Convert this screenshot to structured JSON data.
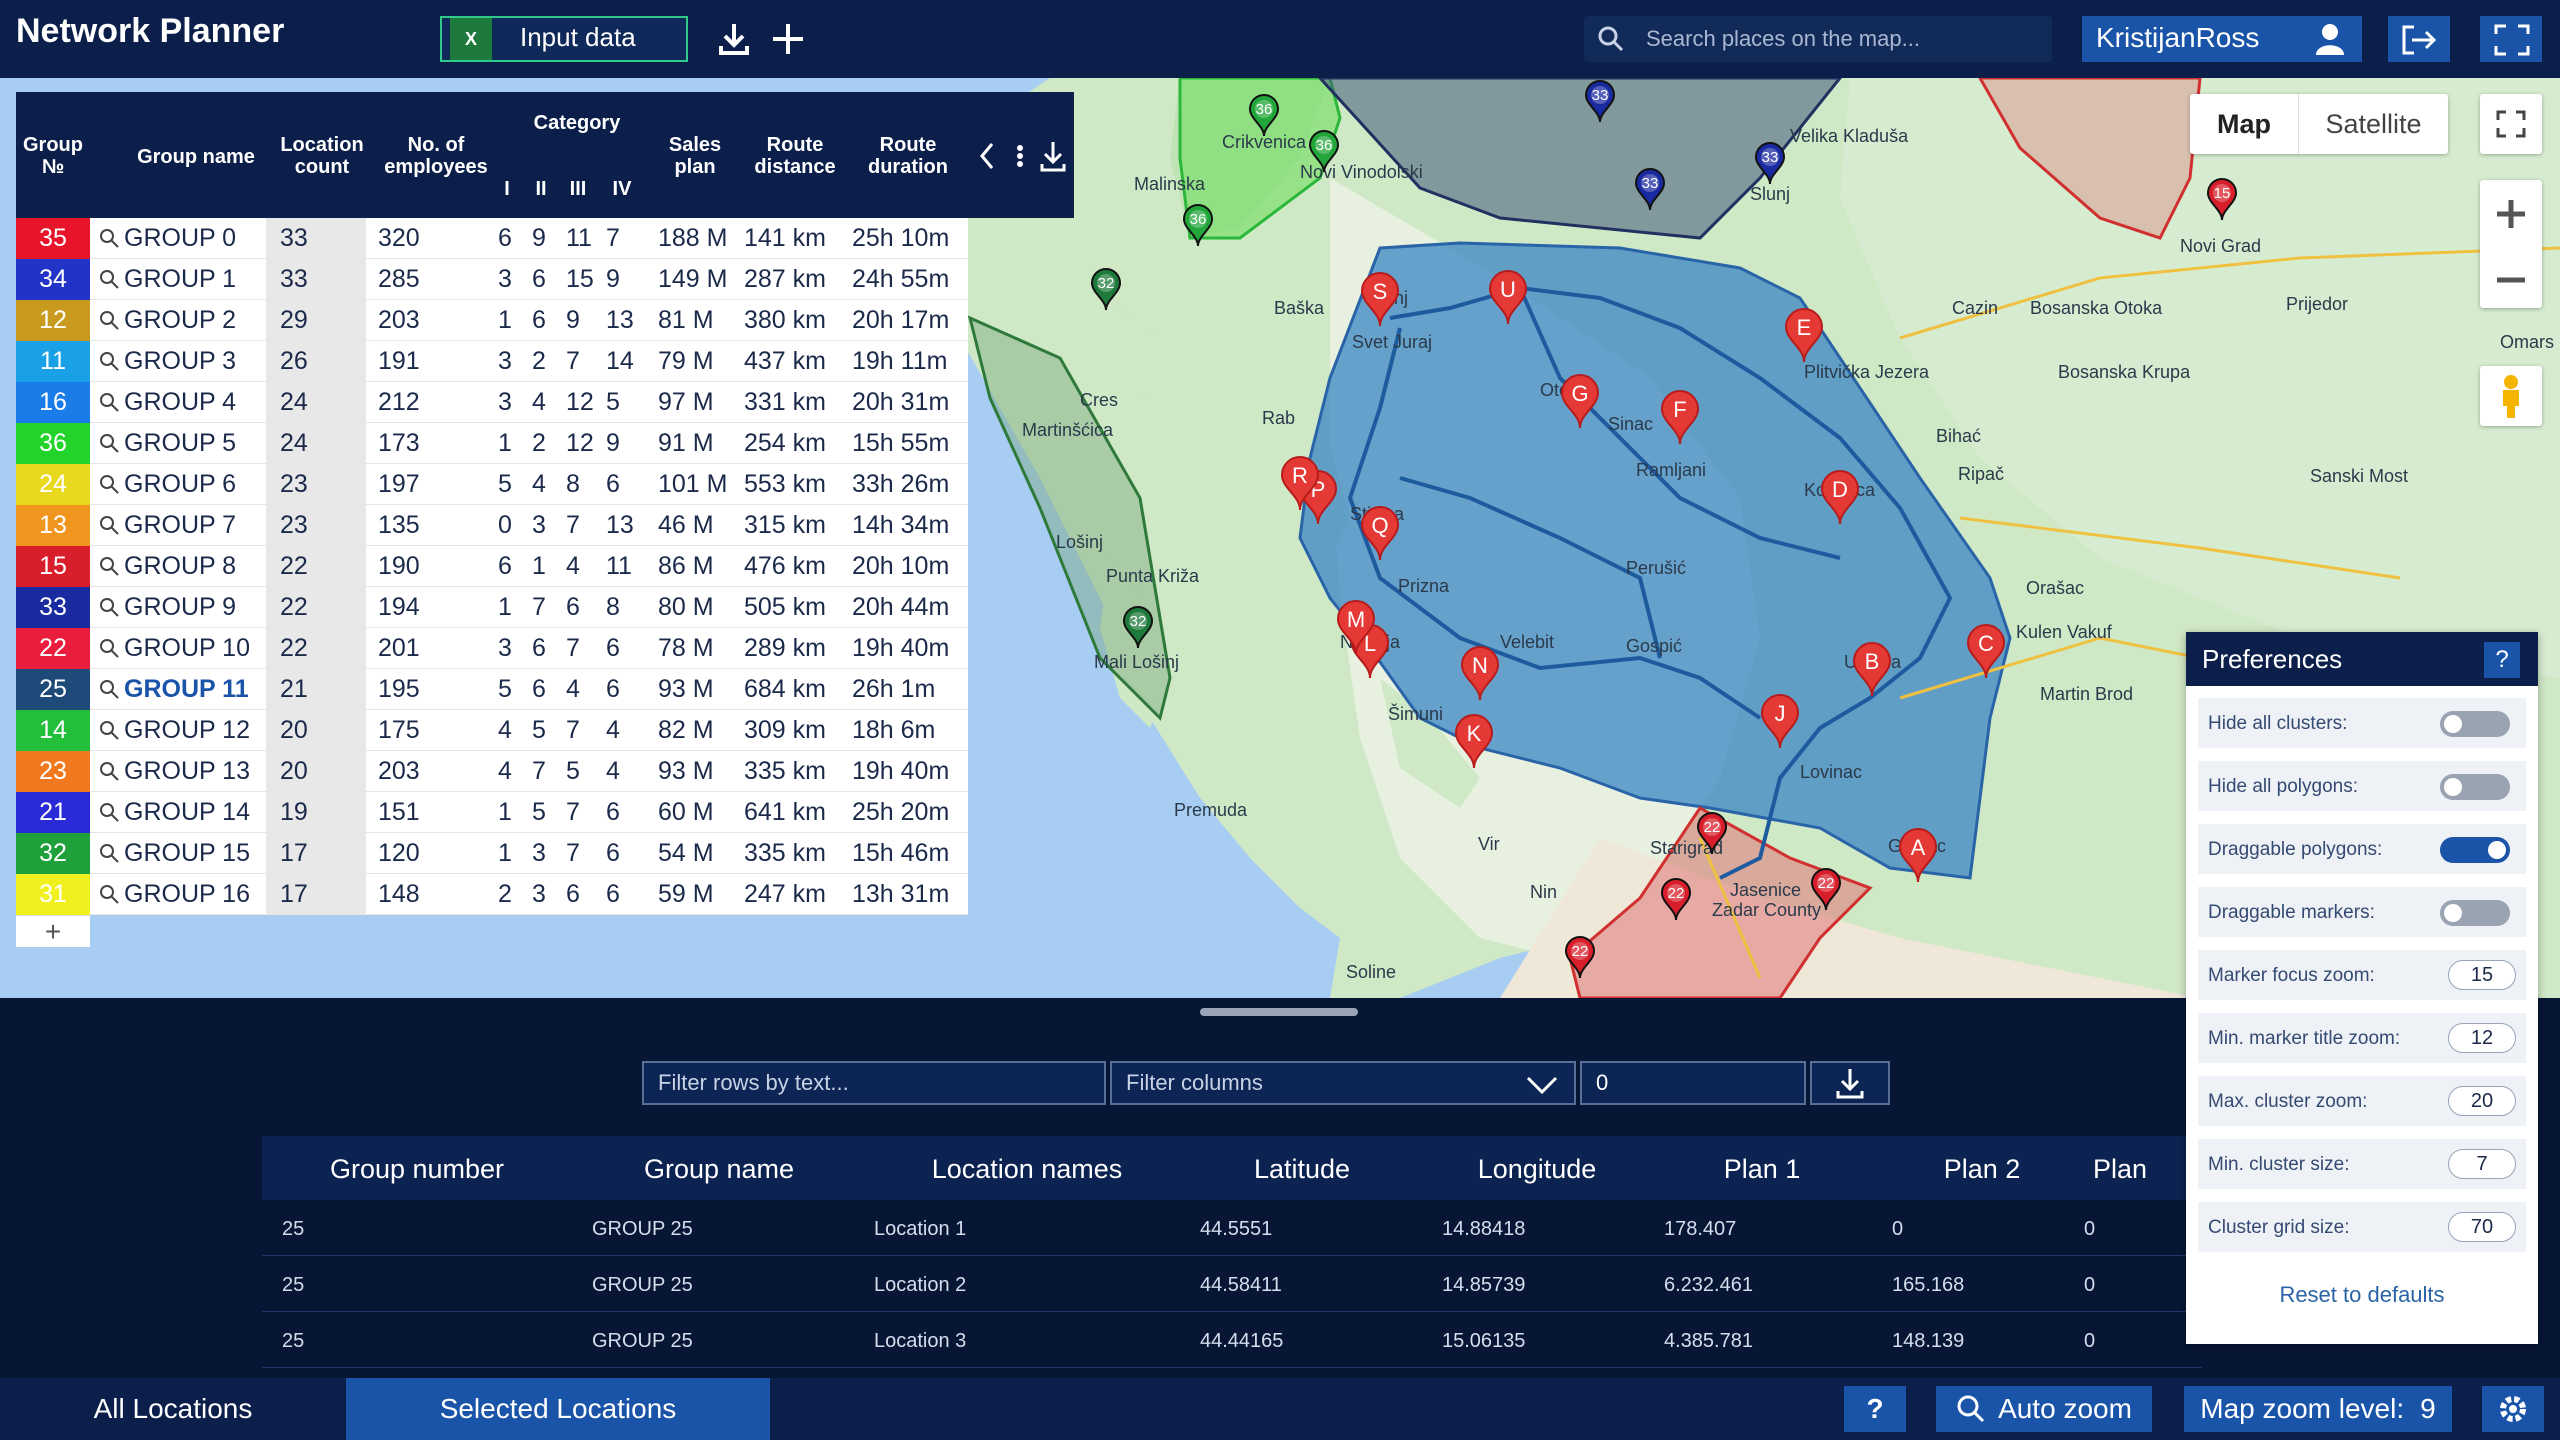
{
  "app": {
    "title": "Network Planner",
    "input_data_label": "Input data",
    "search_placeholder": "Search places on the map...",
    "user_name": "KristijanRoss"
  },
  "map": {
    "type_map": "Map",
    "type_satellite": "Satellite",
    "places": [
      "Crikvenica",
      "Novi Vinodolski",
      "Malinska",
      "Baška",
      "Senj",
      "Svet Juraj",
      "Cres",
      "Martinšćica",
      "Lošinj",
      "Punta Križa",
      "Mali Lošinj",
      "Otočac",
      "Sinac",
      "Plitvička Jezera",
      "Ramljani",
      "Korenica",
      "Bihać",
      "Ripač",
      "Perušić",
      "Gospić",
      "Udbina",
      "Lovinac",
      "Velebit",
      "Premuda",
      "Šimuni",
      "Novalja",
      "Prizna",
      "Stinica",
      "Rab",
      "Vir",
      "Starigrad",
      "Jasenice",
      "Zadar County",
      "Nin",
      "Soline",
      "Gračac",
      "Velika Kladuša",
      "Cazin",
      "Bosanska Otoka",
      "Bosanska Krupa",
      "Prijedor",
      "Sanski Most",
      "Novi Grad",
      "Kulen Vakuf",
      "Orašac",
      "Martin Brod",
      "Slunj",
      "Omars"
    ],
    "pins": [
      "A",
      "B",
      "C",
      "D",
      "E",
      "F",
      "G",
      "J",
      "K",
      "L",
      "M",
      "N",
      "P",
      "Q",
      "R",
      "S",
      "U"
    ],
    "cluster_labels": [
      "33",
      "33",
      "33",
      "36",
      "36",
      "36",
      "32",
      "32",
      "22",
      "22",
      "22",
      "22",
      "15"
    ]
  },
  "group_table": {
    "headers": {
      "group_no": "Group №",
      "group_name": "Group name",
      "location_count": "Location count",
      "employees": "No. of employees",
      "category": "Category",
      "cat_I": "I",
      "cat_II": "II",
      "cat_III": "III",
      "cat_IV": "IV",
      "sales_plan": "Sales plan",
      "route_distance": "Route distance",
      "route_duration": "Route duration"
    },
    "rows": [
      {
        "num": "35",
        "color": "#e8142a",
        "name": "GROUP 0",
        "count": "33",
        "emp": "320",
        "c1": "6",
        "c2": "9",
        "c3": "11",
        "c4": "7",
        "sales": "188 M",
        "dist": "141 km",
        "dur": "25h 10m"
      },
      {
        "num": "34",
        "color": "#2233c8",
        "name": "GROUP 1",
        "count": "33",
        "emp": "285",
        "c1": "3",
        "c2": "6",
        "c3": "15",
        "c4": "9",
        "sales": "149 M",
        "dist": "287 km",
        "dur": "24h 55m"
      },
      {
        "num": "12",
        "color": "#c89b1e",
        "name": "GROUP 2",
        "count": "29",
        "emp": "203",
        "c1": "1",
        "c2": "6",
        "c3": "9",
        "c4": "13",
        "sales": "81 M",
        "dist": "380 km",
        "dur": "20h 17m"
      },
      {
        "num": "11",
        "color": "#1aa0e6",
        "name": "GROUP 3",
        "count": "26",
        "emp": "191",
        "c1": "3",
        "c2": "2",
        "c3": "7",
        "c4": "14",
        "sales": "79 M",
        "dist": "437 km",
        "dur": "19h 11m"
      },
      {
        "num": "16",
        "color": "#1a7ce8",
        "name": "GROUP 4",
        "count": "24",
        "emp": "212",
        "c1": "3",
        "c2": "4",
        "c3": "12",
        "c4": "5",
        "sales": "97 M",
        "dist": "331 km",
        "dur": "20h 31m"
      },
      {
        "num": "36",
        "color": "#22d42a",
        "name": "GROUP 5",
        "count": "24",
        "emp": "173",
        "c1": "1",
        "c2": "2",
        "c3": "12",
        "c4": "9",
        "sales": "91 M",
        "dist": "254 km",
        "dur": "15h 55m"
      },
      {
        "num": "24",
        "color": "#e8d81e",
        "name": "GROUP 6",
        "count": "23",
        "emp": "197",
        "c1": "5",
        "c2": "4",
        "c3": "8",
        "c4": "6",
        "sales": "101 M",
        "dist": "553 km",
        "dur": "33h 26m"
      },
      {
        "num": "13",
        "color": "#f0961e",
        "name": "GROUP 7",
        "count": "23",
        "emp": "135",
        "c1": "0",
        "c2": "3",
        "c3": "7",
        "c4": "13",
        "sales": "46 M",
        "dist": "315 km",
        "dur": "14h 34m"
      },
      {
        "num": "15",
        "color": "#d81e2a",
        "name": "GROUP 8",
        "count": "22",
        "emp": "190",
        "c1": "6",
        "c2": "1",
        "c3": "4",
        "c4": "11",
        "sales": "86 M",
        "dist": "476 km",
        "dur": "20h 10m"
      },
      {
        "num": "33",
        "color": "#1a2aa0",
        "name": "GROUP 9",
        "count": "22",
        "emp": "194",
        "c1": "1",
        "c2": "7",
        "c3": "6",
        "c4": "8",
        "sales": "80 M",
        "dist": "505 km",
        "dur": "20h 44m"
      },
      {
        "num": "22",
        "color": "#e81e3c",
        "name": "GROUP 10",
        "count": "22",
        "emp": "201",
        "c1": "3",
        "c2": "6",
        "c3": "7",
        "c4": "6",
        "sales": "78 M",
        "dist": "289 km",
        "dur": "19h 40m"
      },
      {
        "num": "25",
        "color": "#1e4a7a",
        "name": "GROUP 11",
        "count": "21",
        "emp": "195",
        "c1": "5",
        "c2": "6",
        "c3": "4",
        "c4": "6",
        "sales": "93 M",
        "dist": "684 km",
        "dur": "26h 1m"
      },
      {
        "num": "14",
        "color": "#22c03a",
        "name": "GROUP 12",
        "count": "20",
        "emp": "175",
        "c1": "4",
        "c2": "5",
        "c3": "7",
        "c4": "4",
        "sales": "82 M",
        "dist": "309 km",
        "dur": "18h 6m"
      },
      {
        "num": "23",
        "color": "#f0781e",
        "name": "GROUP 13",
        "count": "20",
        "emp": "203",
        "c1": "4",
        "c2": "7",
        "c3": "5",
        "c4": "4",
        "sales": "93 M",
        "dist": "335 km",
        "dur": "19h 40m"
      },
      {
        "num": "21",
        "color": "#2a2ad8",
        "name": "GROUP 14",
        "count": "19",
        "emp": "151",
        "c1": "1",
        "c2": "5",
        "c3": "7",
        "c4": "6",
        "sales": "60 M",
        "dist": "641 km",
        "dur": "25h 20m"
      },
      {
        "num": "32",
        "color": "#1ea03a",
        "name": "GROUP 15",
        "count": "17",
        "emp": "120",
        "c1": "1",
        "c2": "3",
        "c3": "7",
        "c4": "6",
        "sales": "54 M",
        "dist": "335 km",
        "dur": "15h 46m"
      },
      {
        "num": "31",
        "color": "#f0f01e",
        "name": "GROUP 16",
        "count": "17",
        "emp": "148",
        "c1": "2",
        "c2": "3",
        "c3": "6",
        "c4": "6",
        "sales": "59 M",
        "dist": "247 km",
        "dur": "13h 31m"
      }
    ],
    "add_label": "+"
  },
  "filters": {
    "text_placeholder": "Filter rows by text...",
    "columns_label": "Filter columns",
    "number_value": "0"
  },
  "locations_table": {
    "headers": [
      "Group number",
      "Group name",
      "Location names",
      "Latitude",
      "Longitude",
      "Plan 1",
      "Plan 2",
      "Plan"
    ],
    "rows": [
      [
        "25",
        "GROUP 25",
        "Location 1",
        "44.5551",
        "14.88418",
        "178.407",
        "0",
        "0"
      ],
      [
        "25",
        "GROUP 25",
        "Location 2",
        "44.58411",
        "14.85739",
        "6.232.461",
        "165.168",
        "0"
      ],
      [
        "25",
        "GROUP 25",
        "Location 3",
        "44.44165",
        "15.06135",
        "4.385.781",
        "148.139",
        "0"
      ]
    ]
  },
  "preferences": {
    "title": "Preferences",
    "help": "?",
    "items": [
      {
        "label": "Hide all clusters:",
        "type": "toggle",
        "on": false
      },
      {
        "label": "Hide all polygons:",
        "type": "toggle",
        "on": false
      },
      {
        "label": "Draggable polygons:",
        "type": "toggle",
        "on": true
      },
      {
        "label": "Draggable markers:",
        "type": "toggle",
        "on": false
      },
      {
        "label": "Marker focus zoom:",
        "type": "number",
        "value": "15"
      },
      {
        "label": "Min. marker title zoom:",
        "type": "number",
        "value": "12"
      },
      {
        "label": "Max. cluster zoom:",
        "type": "number",
        "value": "20"
      },
      {
        "label": "Min. cluster size:",
        "type": "number",
        "value": "7"
      },
      {
        "label": "Cluster grid size:",
        "type": "number",
        "value": "70"
      }
    ],
    "reset_label": "Reset to defaults"
  },
  "bottom_bar": {
    "all_locations": "All Locations",
    "selected_locations": "Selected Locations",
    "help": "?",
    "auto_zoom": "Auto zoom",
    "zoom_label": "Map zoom level:",
    "zoom_value": "9"
  },
  "colors": {
    "navy": "#0b1f4a",
    "accent_blue": "#1a54a8",
    "green": "#2fc98a",
    "pin_red": "#e53935"
  }
}
